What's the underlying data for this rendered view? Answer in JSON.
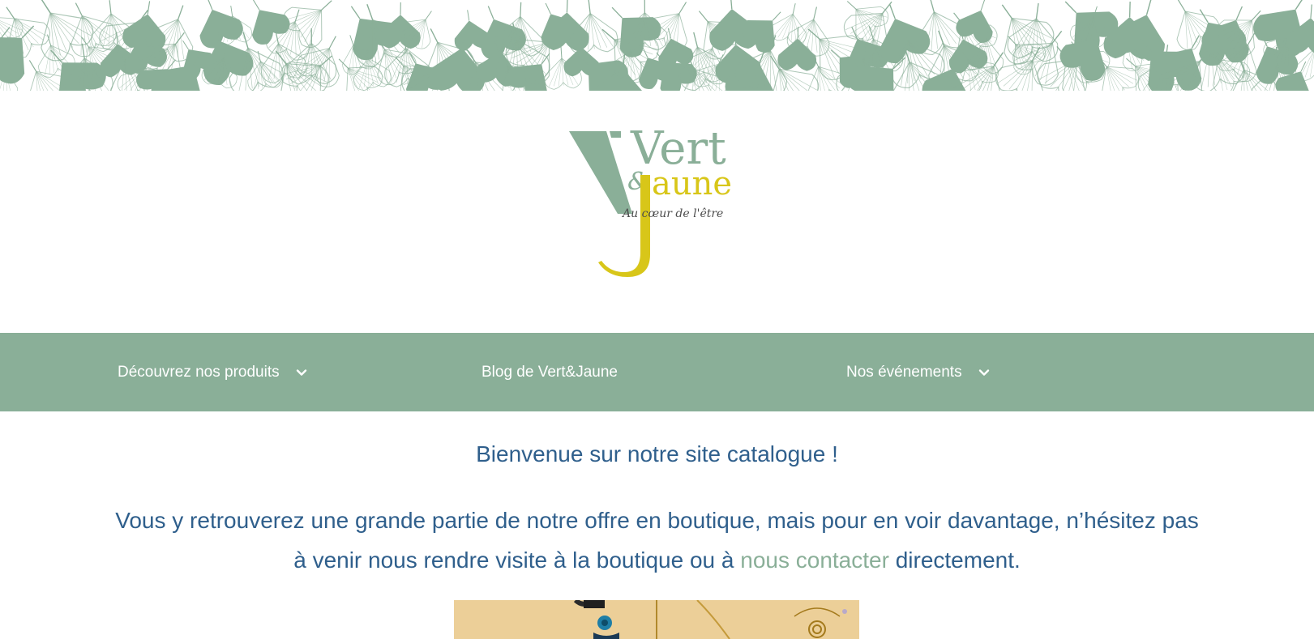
{
  "brand": {
    "logo_line1": "Vert",
    "logo_ampersand": "&",
    "logo_line2": "aune",
    "logo_tagline": "Au cœur de l'être",
    "colors": {
      "green": "#8aaf98",
      "yellow": "#d8c619",
      "text_blue": "#2f5f8c",
      "white": "#ffffff"
    }
  },
  "nav": {
    "items": [
      {
        "label": "Découvrez nos produits",
        "has_dropdown": true,
        "icon": "chevron-down-icon"
      },
      {
        "label": "Blog de Vert&Jaune",
        "has_dropdown": false
      },
      {
        "label": "Nos événements",
        "has_dropdown": true,
        "icon": "chevron-down-icon"
      }
    ]
  },
  "content": {
    "welcome": "Bienvenue sur notre site catalogue !",
    "intro_before_link": "Vous y retrouverez une grande partie de notre offre en boutique, mais pour en voir davantage, n’hésitez pas à venir nous rendre visite à la boutique ou à ",
    "intro_link": "nous contacter",
    "intro_after_link": " directement."
  },
  "decor": {
    "banner": "ginkgo-leaf-pattern",
    "photo": "jewelry-display-photo"
  }
}
